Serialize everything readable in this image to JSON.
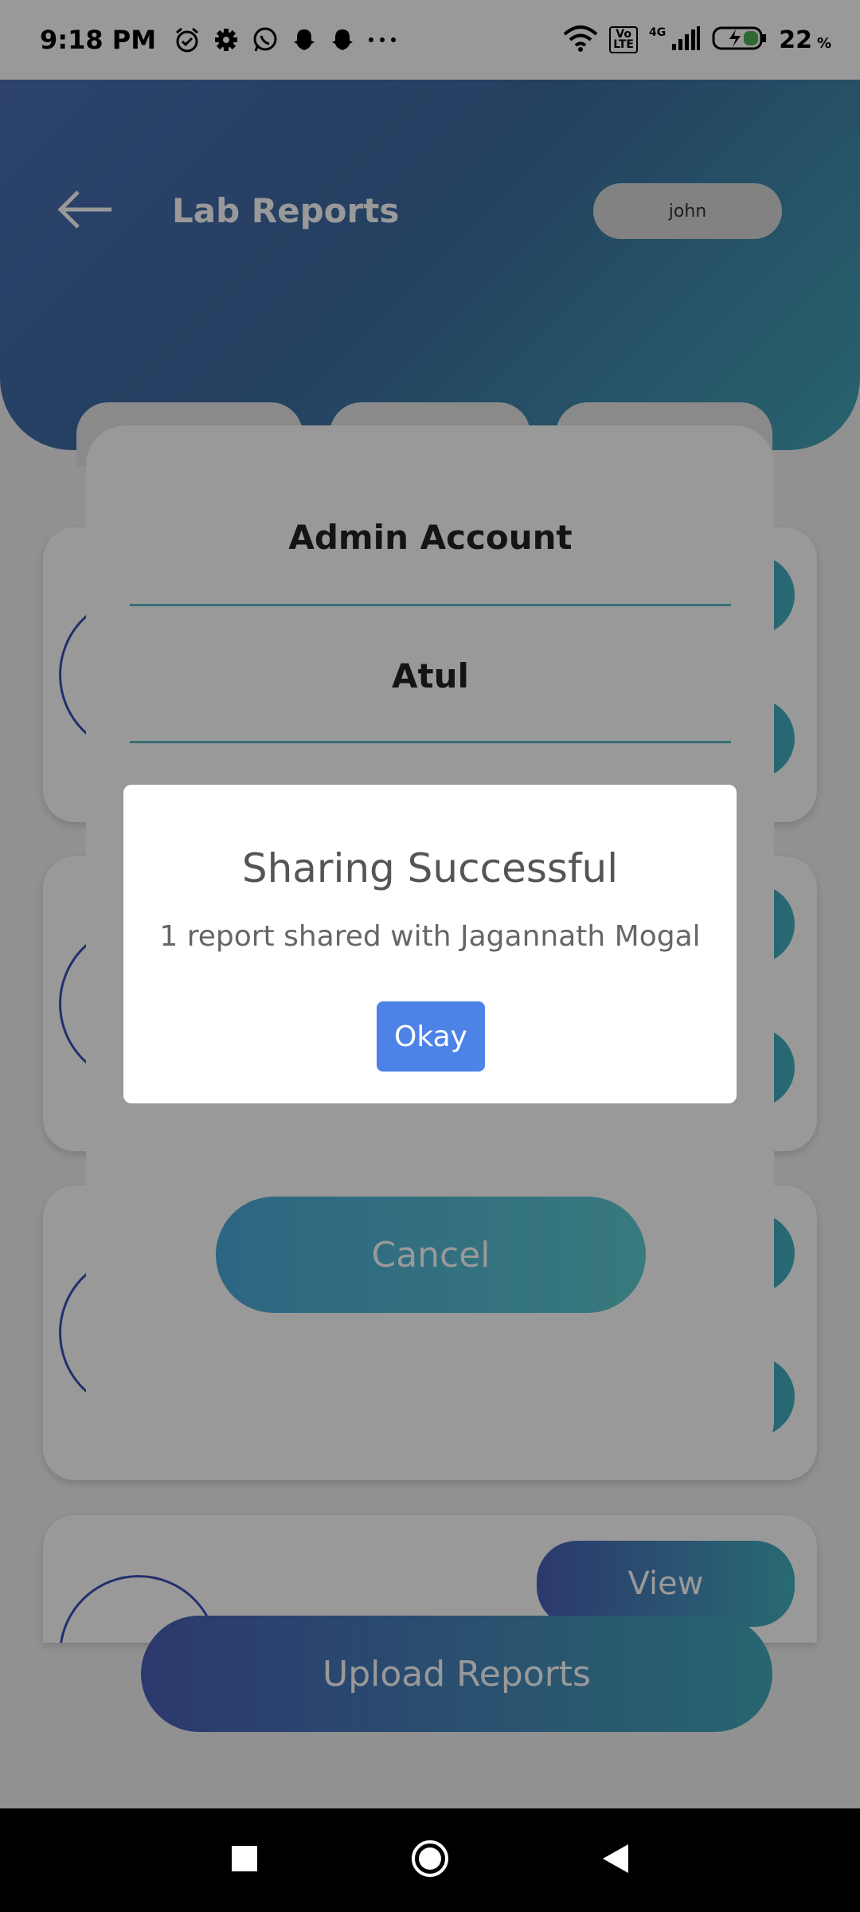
{
  "status_bar": {
    "time": "9:18 PM",
    "icons": [
      "alarm-icon",
      "gear-icon",
      "whatsapp-icon",
      "snapchat-icon",
      "snapchat-icon",
      "more-dots-icon"
    ],
    "volte": "Vo\nLTE",
    "network": "4G",
    "battery": "22",
    "battery_unit": "%"
  },
  "header": {
    "title": "Lab Reports",
    "user": "john"
  },
  "cards": {
    "view_label": "View"
  },
  "sheet": {
    "items": [
      "Admin Account",
      "Atul"
    ],
    "cancel_label": "Cancel"
  },
  "dialog": {
    "title": "Sharing Successful",
    "message": "1 report shared with Jagannath Mogal",
    "okay_label": "Okay"
  },
  "upload": {
    "label": "Upload Reports"
  },
  "colors": {
    "primary_blue": "#4a5fb8",
    "teal": "#43a9bb",
    "okay_button": "#4d82e6"
  }
}
